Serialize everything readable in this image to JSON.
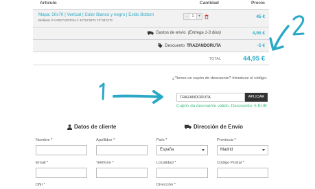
{
  "cart": {
    "headers": {
      "article": "Artículo",
      "quantity": "Cantidad",
      "price": "Precio"
    },
    "item": {
      "title": "Mapa: 50x70 | Vertical | Color Blanco y negro | Estilo Bottom",
      "location": "Bishkek // KYRGYZSTAN // 42°52'28\"N 74°34'11\"E",
      "qty_minus": "-",
      "qty_value": "1",
      "qty_plus": "+",
      "price": "45 €"
    },
    "shipping": {
      "label": "Gastos de envío",
      "note": "(Entrega 1-3 días)",
      "price": "4,95 €"
    },
    "discount": {
      "label": "Descuento",
      "code": "TRAZANDORUTA",
      "price": "-5 €"
    },
    "total": {
      "label": "TOTAL",
      "price": "44,95 €"
    }
  },
  "coupon": {
    "question": "¿Tienes un cupón de descuento? Introduce el código:",
    "input_value": "TRAZANDORUTA",
    "apply_label": "APLICAR",
    "success": "Cupón de descuento válido. Descuento: 5 EUR"
  },
  "annotations": {
    "one": "1",
    "two": "2",
    "color": "#29a9c6"
  },
  "form": {
    "client_title": "Datos de cliente",
    "shipping_title": "Dirección de Envío",
    "nombre": "Nombre *",
    "apellidos": "Apellidos *",
    "email": "Email *",
    "telefono": "Teléfono *",
    "dni": "DNI *",
    "pais": "País *",
    "pais_value": "España",
    "provincia": "Provincia *",
    "provincia_value": "Madrid",
    "localidad": "Localidad *",
    "codigo_postal": "Código Postal *",
    "direccion": "Dirección *"
  },
  "colors": {
    "accent": "#29a9c6",
    "success": "#3dbb7a",
    "button_dark": "#333333"
  }
}
